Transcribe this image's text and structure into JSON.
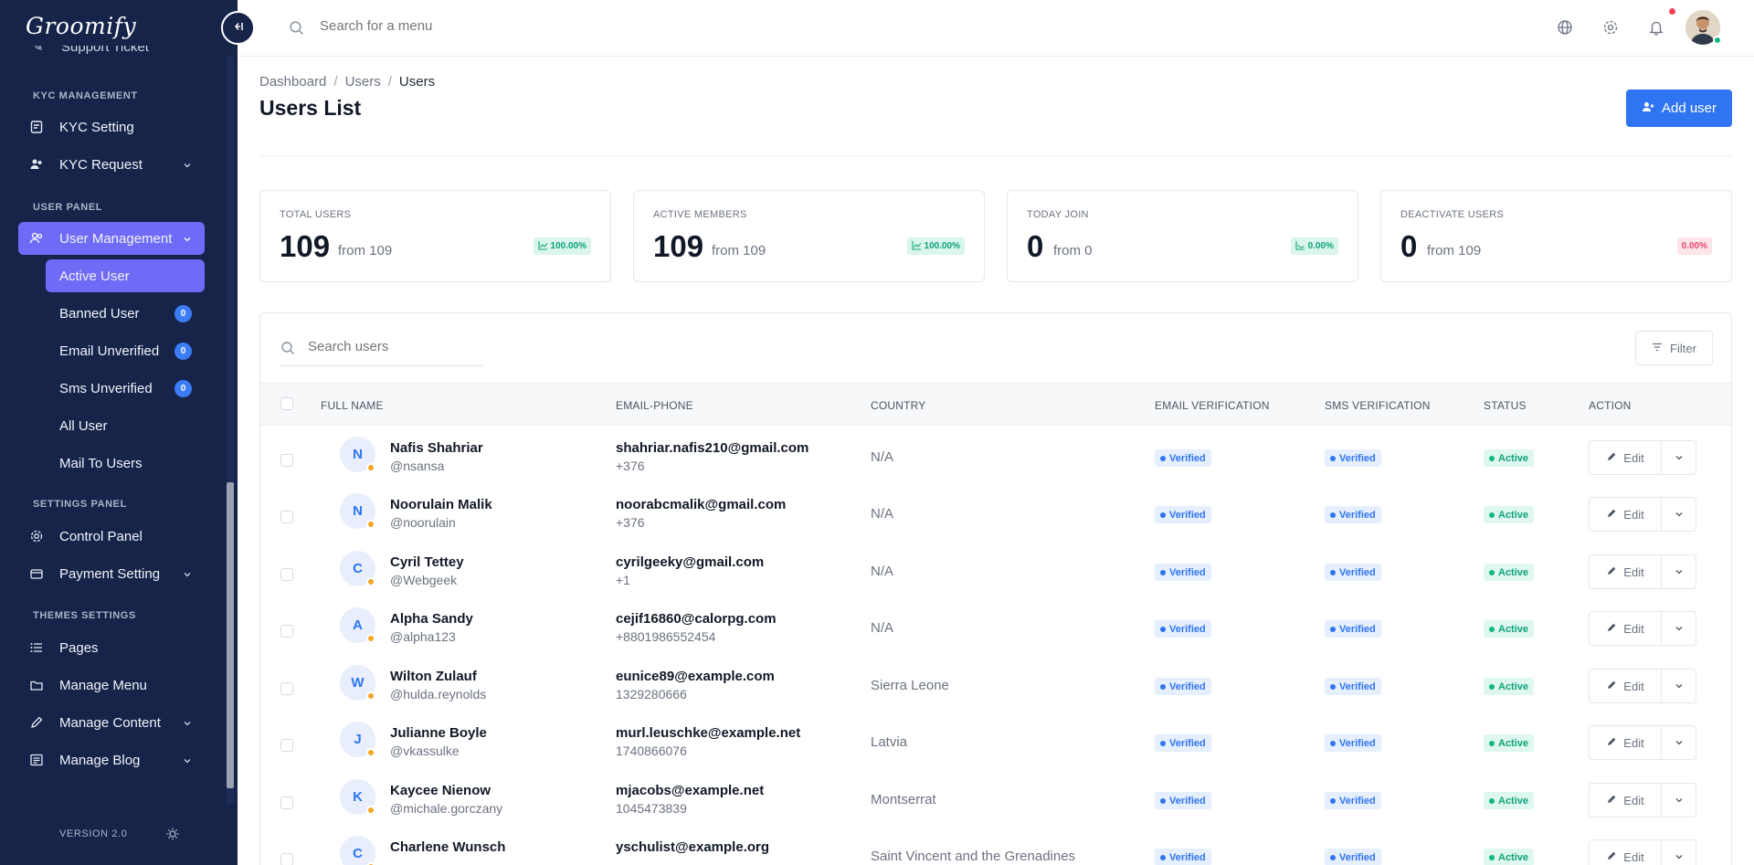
{
  "brand": "Groomify",
  "sidebar": {
    "partial_item": "Support Ticket",
    "sections": {
      "kyc": "KYC MANAGEMENT",
      "user": "USER PANEL",
      "settings": "SETTINGS PANEL",
      "themes": "THEMES SETTINGS"
    },
    "items": {
      "kyc_setting": "KYC Setting",
      "kyc_request": "KYC Request",
      "user_management": "User Management",
      "control_panel": "Control Panel",
      "payment_setting": "Payment Setting",
      "pages": "Pages",
      "manage_menu": "Manage Menu",
      "manage_content": "Manage Content",
      "manage_blog": "Manage Blog"
    },
    "sub_items": [
      {
        "label": "Active User",
        "badge": null
      },
      {
        "label": "Banned User",
        "badge": "0"
      },
      {
        "label": "Email Unverified",
        "badge": "0"
      },
      {
        "label": "Sms Unverified",
        "badge": "0"
      },
      {
        "label": "All User",
        "badge": null
      },
      {
        "label": "Mail To Users",
        "badge": null
      }
    ],
    "version": "VERSION 2.0"
  },
  "topbar": {
    "search_placeholder": "Search for a menu"
  },
  "breadcrumb": [
    "Dashboard",
    "Users",
    "Users"
  ],
  "page_title": "Users List",
  "add_user_label": "Add user",
  "stats": [
    {
      "label": "TOTAL USERS",
      "value": "109",
      "from": "from 109",
      "pct": "100.00%",
      "tone": "green"
    },
    {
      "label": "ACTIVE MEMBERS",
      "value": "109",
      "from": "from 109",
      "pct": "100.00%",
      "tone": "green"
    },
    {
      "label": "TODAY JOIN",
      "value": "0",
      "from": "from 0",
      "pct": "0.00%",
      "tone": "green"
    },
    {
      "label": "DEACTIVATE USERS",
      "value": "0",
      "from": "from 109",
      "pct": "0.00%",
      "tone": "red"
    }
  ],
  "table": {
    "search_placeholder": "Search users",
    "filter_label": "Filter",
    "columns": [
      "FULL NAME",
      "EMAIL-PHONE",
      "COUNTRY",
      "EMAIL VERIFICATION",
      "SMS VERIFICATION",
      "STATUS",
      "ACTION"
    ],
    "edit_label": "Edit",
    "rows": [
      {
        "initial": "N",
        "name": "Nafis Shahriar",
        "handle": "@nsansa",
        "email": "shahriar.nafis210@gmail.com",
        "phone": "+376",
        "country": "N/A",
        "email_ver": "Verified",
        "sms_ver": "Verified",
        "status": "Active"
      },
      {
        "initial": "N",
        "name": "Noorulain Malik",
        "handle": "@noorulain",
        "email": "noorabcmalik@gmail.com",
        "phone": "+376",
        "country": "N/A",
        "email_ver": "Verified",
        "sms_ver": "Verified",
        "status": "Active"
      },
      {
        "initial": "C",
        "name": "Cyril Tettey",
        "handle": "@Webgeek",
        "email": "cyrilgeeky@gmail.com",
        "phone": "+1",
        "country": "N/A",
        "email_ver": "Verified",
        "sms_ver": "Verified",
        "status": "Active"
      },
      {
        "initial": "A",
        "name": "Alpha Sandy",
        "handle": "@alpha123",
        "email": "cejif16860@calorpg.com",
        "phone": "+8801986552454",
        "country": "N/A",
        "email_ver": "Verified",
        "sms_ver": "Verified",
        "status": "Active"
      },
      {
        "initial": "W",
        "name": "Wilton Zulauf",
        "handle": "@hulda.reynolds",
        "email": "eunice89@example.com",
        "phone": "1329280666",
        "country": "Sierra Leone",
        "email_ver": "Verified",
        "sms_ver": "Verified",
        "status": "Active"
      },
      {
        "initial": "J",
        "name": "Julianne Boyle",
        "handle": "@vkassulke",
        "email": "murl.leuschke@example.net",
        "phone": "1740866076",
        "country": "Latvia",
        "email_ver": "Verified",
        "sms_ver": "Verified",
        "status": "Active"
      },
      {
        "initial": "K",
        "name": "Kaycee Nienow",
        "handle": "@michale.gorczany",
        "email": "mjacobs@example.net",
        "phone": "1045473839",
        "country": "Montserrat",
        "email_ver": "Verified",
        "sms_ver": "Verified",
        "status": "Active"
      },
      {
        "initial": "C",
        "name": "Charlene Wunsch",
        "handle": "",
        "email": "yschulist@example.org",
        "phone": "",
        "country": "Saint Vincent and the Grenadines",
        "email_ver": "Verified",
        "sms_ver": "Verified",
        "status": "Active"
      }
    ]
  },
  "colors": {
    "sidebar_bg": "#16244a",
    "sidebar_active": "#6f6bf7",
    "primary": "#2f75f1",
    "success": "#10b981",
    "danger": "#f43f5e"
  }
}
